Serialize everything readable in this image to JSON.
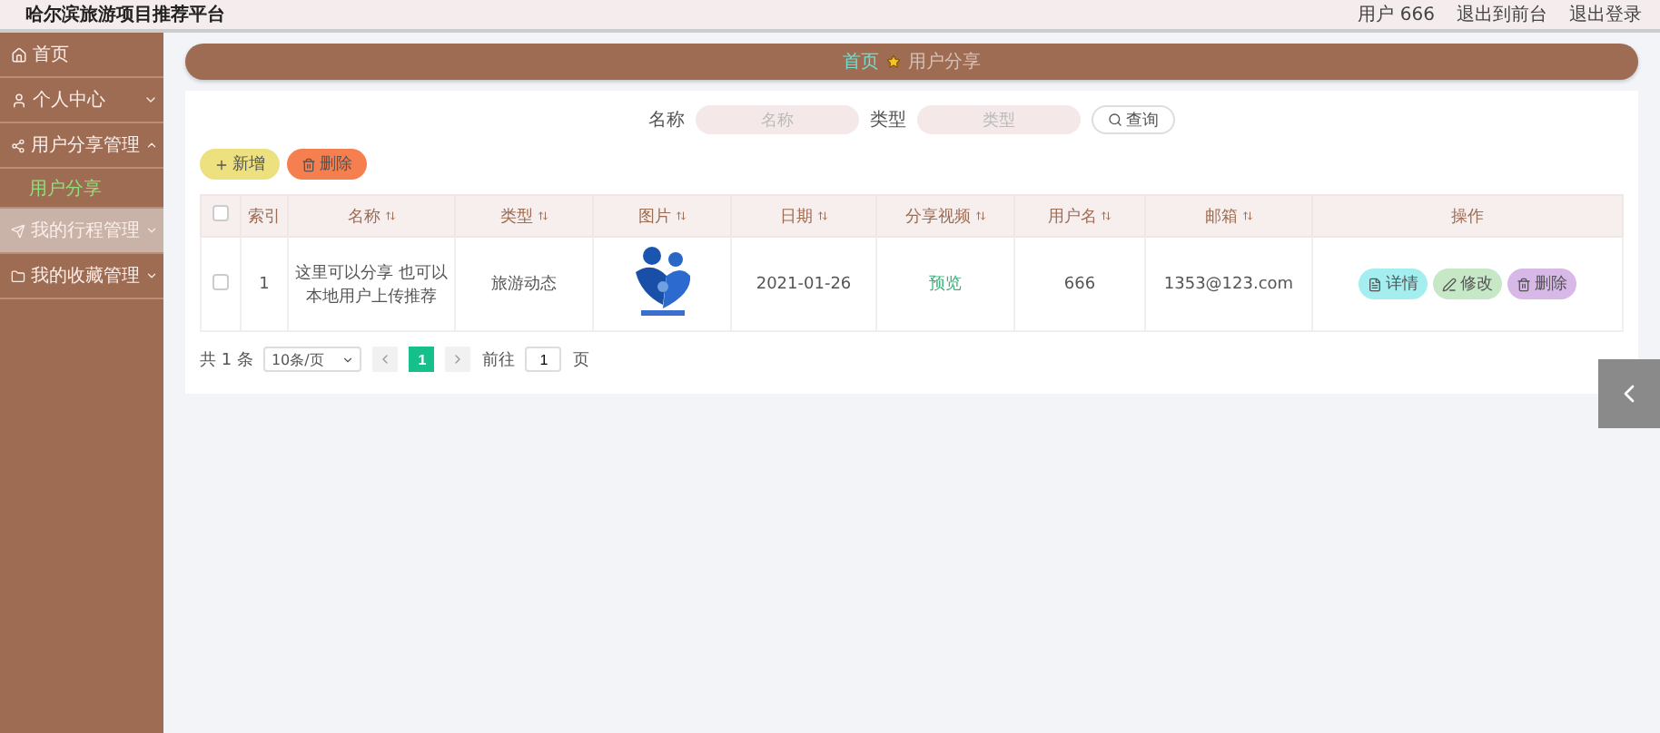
{
  "header": {
    "title": "哈尔滨旅游项目推荐平台",
    "links": [
      "用户 666",
      "退出到前台",
      "退出登录"
    ]
  },
  "sidebar": {
    "items": [
      {
        "label": "首页",
        "kind": "home",
        "highlighted": false
      },
      {
        "label": "个人中心",
        "kind": "user",
        "expanded": false,
        "highlighted": false
      },
      {
        "label": "用户分享管理",
        "kind": "share",
        "expanded": true,
        "highlighted": false,
        "children": [
          {
            "label": "用户分享",
            "selected": true
          }
        ]
      },
      {
        "label": "我的行程管理",
        "kind": "plane",
        "expanded": false,
        "highlighted": true
      },
      {
        "label": "我的收藏管理",
        "kind": "folder",
        "expanded": false,
        "highlighted": false
      }
    ]
  },
  "breadcrumb": [
    "首页",
    "用户分享"
  ],
  "search": {
    "fields": [
      {
        "label": "名称",
        "placeholder": "名称"
      },
      {
        "label": "类型",
        "placeholder": "类型"
      }
    ],
    "button": "查询"
  },
  "actions": [
    {
      "label": "新增",
      "kind": "add"
    },
    {
      "label": "删除",
      "kind": "delete"
    }
  ],
  "table": {
    "header_checked": false,
    "columns": [
      {
        "label": "索引",
        "sortable": false
      },
      {
        "label": "名称",
        "sortable": true
      },
      {
        "label": "类型",
        "sortable": true
      },
      {
        "label": "图片",
        "sortable": true
      },
      {
        "label": "日期",
        "sortable": true
      },
      {
        "label": "分享视频",
        "sortable": true
      },
      {
        "label": "用户名",
        "sortable": true
      },
      {
        "label": "邮箱",
        "sortable": true
      },
      {
        "label": "操作",
        "sortable": false
      }
    ],
    "rows": [
      {
        "checked": false,
        "index": "1",
        "name": "这里可以分享 也可以本地用户上传推荐",
        "type": "旅游动态",
        "date": "2021-01-26",
        "video": "预览",
        "username": "666",
        "email": "1353@123.com",
        "buttons": [
          {
            "label": "详情",
            "kind": "detail"
          },
          {
            "label": "修改",
            "kind": "edit"
          },
          {
            "label": "删除",
            "kind": "delete"
          }
        ]
      }
    ]
  },
  "pagination": {
    "total": "共 1 条",
    "page_size": "10条/页",
    "pages": [
      {
        "label": "1",
        "selected": true
      }
    ],
    "goto_label": "前往",
    "goto_value": "1",
    "page_unit": "页"
  }
}
